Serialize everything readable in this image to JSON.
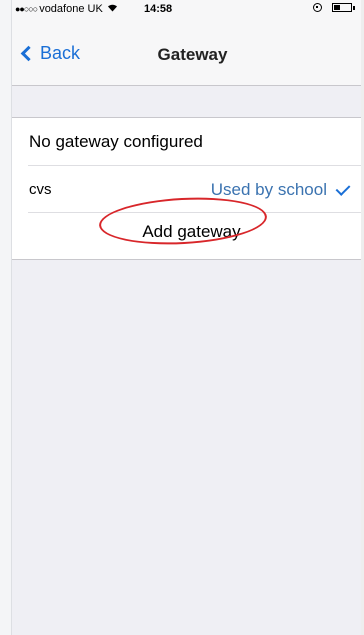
{
  "status_bar": {
    "signal_dots": "●●○○○",
    "carrier": "vodafone UK",
    "time": "14:58",
    "battery_level": 0.35
  },
  "nav": {
    "back_label": "Back",
    "title": "Gateway"
  },
  "table": {
    "rows": [
      {
        "label": "No gateway configured"
      },
      {
        "label": "cvs",
        "detail": "Used by school",
        "checked": true
      }
    ],
    "add_label": "Add gateway"
  },
  "colors": {
    "accent": "#1a6fd6",
    "detail_text": "#3b73b0",
    "annotation": "#d8262a",
    "background": "#efeff4"
  }
}
